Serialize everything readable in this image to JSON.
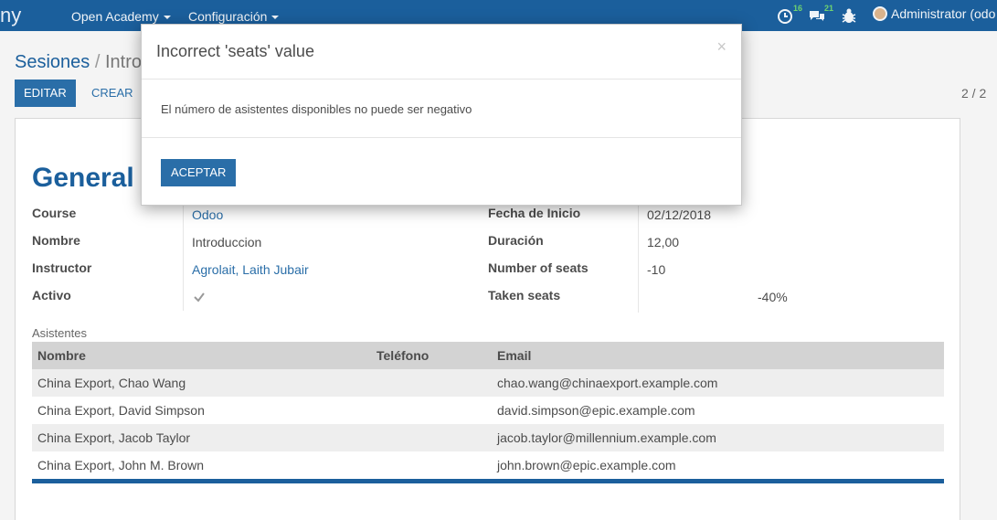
{
  "navbar": {
    "brand_fragment": "ny",
    "menu_open_academy": "Open Academy",
    "menu_config": "Configuración",
    "activity_count": "16",
    "messages_count": "21",
    "user_name": "Administrator (odo"
  },
  "control_panel": {
    "breadcrumb_parent": "Sesiones",
    "breadcrumb_sep": "/",
    "breadcrumb_current": "Intro",
    "edit_label": "EDITAR",
    "create_label": "CREAR",
    "pager": "2 / 2"
  },
  "form": {
    "title": "General",
    "left_fields": [
      {
        "label": "Course",
        "value": "Odoo"
      },
      {
        "label": "Nombre",
        "value": "Introduccion"
      },
      {
        "label": "Instructor",
        "value": "Agrolait, Laith Jubair"
      },
      {
        "label": "Activo",
        "value": "checked"
      }
    ],
    "right_fields": [
      {
        "label": "Fecha de Inicio",
        "value": "02/12/2018"
      },
      {
        "label": "Duración",
        "value": "12,00"
      },
      {
        "label": "Number of seats",
        "value": "-10"
      },
      {
        "label": "Taken seats",
        "value": "-40%"
      }
    ],
    "taken_seats_percent": -40
  },
  "attendees": {
    "section_label": "Asistentes",
    "columns": [
      "Nombre",
      "Teléfono",
      "Email"
    ],
    "rows": [
      {
        "name": "China Export, Chao Wang",
        "phone": "",
        "email": "chao.wang@chinaexport.example.com"
      },
      {
        "name": "China Export, David Simpson",
        "phone": "",
        "email": "david.simpson@epic.example.com"
      },
      {
        "name": "China Export, Jacob Taylor",
        "phone": "",
        "email": "jacob.taylor@millennium.example.com"
      },
      {
        "name": "China Export, John M. Brown",
        "phone": "",
        "email": "john.brown@epic.example.com"
      }
    ]
  },
  "dialog": {
    "title": "Incorrect 'seats' value",
    "close": "×",
    "message": "El número de asistentes disponibles no puede ser negativo",
    "accept_label": "ACEPTAR"
  },
  "colors": {
    "navbar": "#1b5f9c",
    "primary_button": "#2a6ea8",
    "badge": "#6fd36f"
  }
}
